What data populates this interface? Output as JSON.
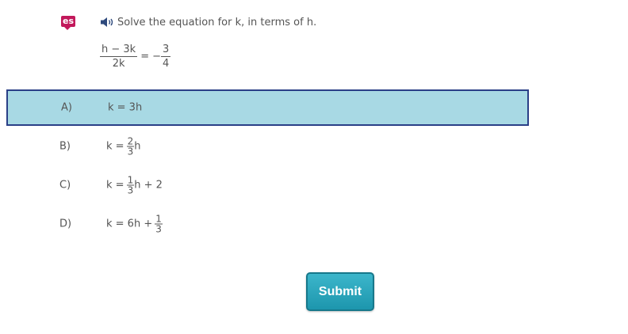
{
  "toolbar": {
    "espanol_icon": "es"
  },
  "question": {
    "audio_icon": "speaker-icon",
    "prompt": "Solve the equation for k, in terms of h.",
    "equation": {
      "num": "h − 3k",
      "den": "2k",
      "eq": "=",
      "neg": "−",
      "rhs_num": "3",
      "rhs_den": "4"
    }
  },
  "choices": [
    {
      "letter": "A)",
      "pre": "k = 3h",
      "selected": true
    },
    {
      "letter": "B)",
      "pre": "k =",
      "fnum": "2",
      "fden": "3",
      "post": "h",
      "selected": false
    },
    {
      "letter": "C)",
      "pre": "k =",
      "fnum": "1",
      "fden": "3",
      "post": "h + 2",
      "selected": false
    },
    {
      "letter": "D)",
      "pre": "k = 6h +",
      "fnum": "1",
      "fden": "3",
      "post": "",
      "selected": false
    }
  ],
  "submit": {
    "label": "Submit"
  },
  "colors": {
    "selected_bg": "#a8d9e4",
    "selected_border": "#2a3f87",
    "submit_bg": "#2aa6bc",
    "es_badge": "#c2185b"
  }
}
